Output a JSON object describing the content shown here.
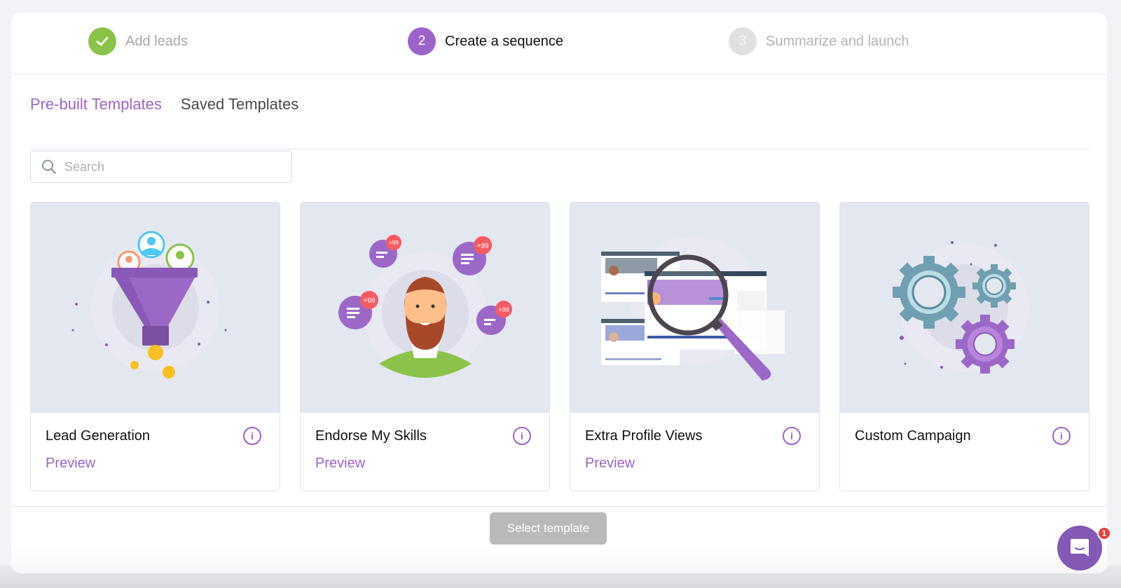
{
  "stepper": {
    "steps": [
      {
        "number": "✓",
        "label": "Add leads",
        "state": "completed"
      },
      {
        "number": "2",
        "label": "Create a sequence",
        "state": "active"
      },
      {
        "number": "3",
        "label": "Summarize and launch",
        "state": "upcoming"
      }
    ]
  },
  "tabs": [
    {
      "label": "Pre-built Templates",
      "active": true
    },
    {
      "label": "Saved Templates",
      "active": false
    }
  ],
  "search": {
    "placeholder": "Search",
    "value": ""
  },
  "cards": [
    {
      "title": "Lead Generation",
      "preview": "Preview",
      "illustration": "funnel-illustration"
    },
    {
      "title": "Endorse My Skills",
      "preview": "Preview",
      "illustration": "endorse-illustration",
      "badge_text": "+99"
    },
    {
      "title": "Extra Profile Views",
      "preview": "Preview",
      "illustration": "magnifier-illustration"
    },
    {
      "title": "Custom Campaign",
      "preview": "",
      "illustration": "gears-illustration"
    }
  ],
  "footer": {
    "select_label": "Select template"
  },
  "chat": {
    "unread_count": "1"
  },
  "colors": {
    "accent": "#9c64c8",
    "success": "#8bc34a",
    "disabled": "#b9b9b9",
    "chat": "#8459b5",
    "badge": "#ee3d3d"
  }
}
